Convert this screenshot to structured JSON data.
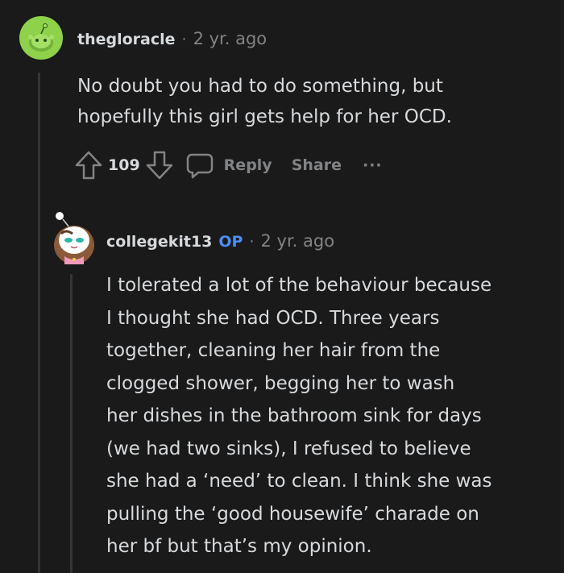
{
  "comments": [
    {
      "author": "thegloracle",
      "separator": "·",
      "time": "2 yr. ago",
      "body_lines": [
        "No doubt you had to do something, but",
        "hopefully this girl gets help for her OCD."
      ],
      "votes": "109",
      "reply_label": "Reply",
      "share_label": "Share",
      "more_label": "···",
      "avatar_color": "#8ed14a"
    },
    {
      "author": "collegekit13",
      "badge": "OP",
      "separator": "·",
      "time": "2 yr. ago",
      "body_lines": [
        "I tolerated a lot of the behaviour because",
        "I thought she had OCD. Three years",
        "together, cleaning her hair from the",
        "clogged shower, begging her to wash",
        "her dishes in the bathroom sink for days",
        "(we had two sinks), I refused to believe",
        "she had a ‘need’ to clean. I think she was",
        "pulling the ‘good housewife’ charade on",
        "her bf but that’s my opinion."
      ]
    }
  ],
  "colors": {
    "background": "#1a1a1b",
    "text": "#d7dadc",
    "muted": "#818384",
    "op_badge": "#4a8ef0",
    "thread_line": "#343536"
  }
}
